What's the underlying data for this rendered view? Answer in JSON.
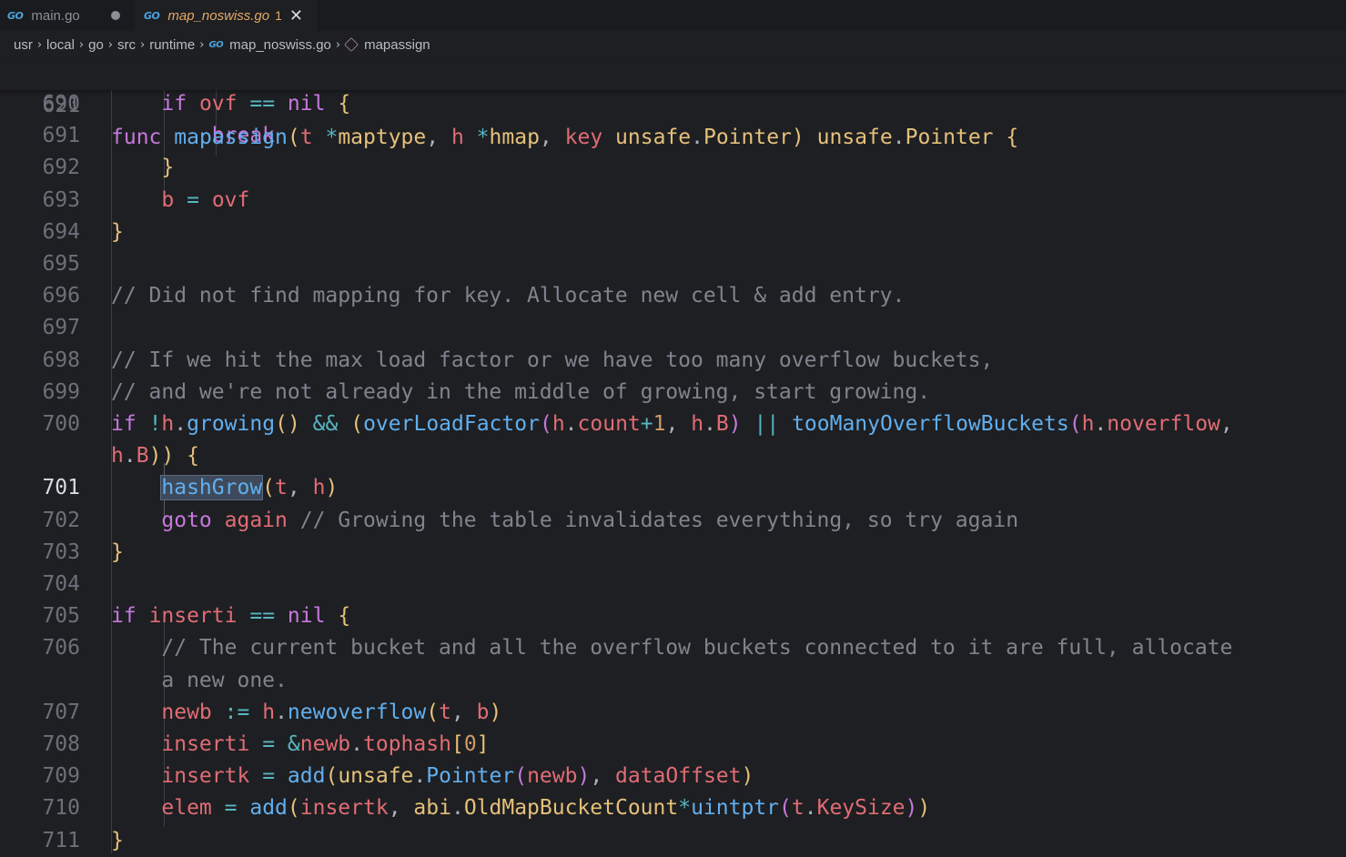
{
  "tabs": [
    {
      "label": "main.go",
      "modified": true
    },
    {
      "label": "map_noswiss.go",
      "problems": "1",
      "active": true
    }
  ],
  "breadcrumb": [
    "usr",
    "local",
    "go",
    "src",
    "runtime",
    "map_noswiss.go",
    "mapassign"
  ],
  "icons": {
    "go_file": "go-file-icon",
    "symbol": "method-cube-icon",
    "close": "close-icon"
  },
  "sticky": {
    "number": "621",
    "text": "func mapassign(t *maptype, h *hmap, key unsafe.Pointer) unsafe.Pointer {"
  },
  "current_line": "701",
  "highlighted_word": "hashGrow",
  "lines": [
    {
      "n": "690",
      "text": "        if ovf == nil {"
    },
    {
      "n": "691",
      "text": "            break"
    },
    {
      "n": "692",
      "text": "        }"
    },
    {
      "n": "693",
      "text": "        b = ovf"
    },
    {
      "n": "694",
      "text": "    }"
    },
    {
      "n": "695",
      "text": ""
    },
    {
      "n": "696",
      "text": "    // Did not find mapping for key. Allocate new cell & add entry."
    },
    {
      "n": "697",
      "text": ""
    },
    {
      "n": "698",
      "text": "    // If we hit the max load factor or we have too many overflow buckets,"
    },
    {
      "n": "699",
      "text": "    // and we're not already in the middle of growing, start growing."
    },
    {
      "n": "700",
      "text": "    if !h.growing() && (overLoadFactor(h.count+1, h.B) || tooManyOverflowBuckets(h.noverflow,"
    },
    {
      "n": "",
      "text": "    h.B)) {"
    },
    {
      "n": "701",
      "text": "        hashGrow(t, h)"
    },
    {
      "n": "702",
      "text": "        goto again // Growing the table invalidates everything, so try again"
    },
    {
      "n": "703",
      "text": "    }"
    },
    {
      "n": "704",
      "text": ""
    },
    {
      "n": "705",
      "text": "    if inserti == nil {"
    },
    {
      "n": "706",
      "text": "        // The current bucket and all the overflow buckets connected to it are full, allocate"
    },
    {
      "n": "",
      "text": "        a new one."
    },
    {
      "n": "707",
      "text": "        newb := h.newoverflow(t, b)"
    },
    {
      "n": "708",
      "text": "        inserti = &newb.tophash[0]"
    },
    {
      "n": "709",
      "text": "        insertk = add(unsafe.Pointer(newb), dataOffset)"
    },
    {
      "n": "710",
      "text": "        elem = add(insertk, abi.OldMapBucketCount*uintptr(t.KeySize))"
    },
    {
      "n": "711",
      "text": "    }"
    }
  ],
  "colors": {
    "background": "#1e1f22",
    "keyword": "#c678dd",
    "function": "#61afef",
    "type": "#e5c07b",
    "variable": "#e06c75",
    "comment": "#7f848e",
    "number": "#d19a66",
    "operator": "#56b6c2"
  }
}
